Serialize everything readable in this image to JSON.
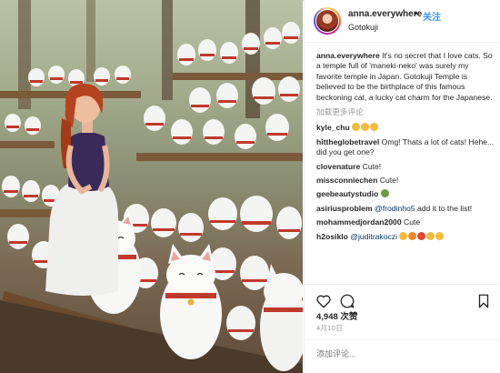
{
  "header": {
    "username": "anna.everywhere",
    "separator": "•",
    "follow_label": "关注",
    "location": "Gotokuji"
  },
  "caption": {
    "username": "anna.everywhere",
    "text": "It's no secret that I love cats. So a temple full of 'maneki-neko' was surely my favorite temple in Japan. Gotokuji Temple is believed to be the birthplace of this famous beckoning cat, a lucky cat charm for the Japanese."
  },
  "load_more": "加载更多评论",
  "comments": [
    {
      "username": "kyle_chu",
      "text": "",
      "emoji": [
        "#f6b93b",
        "#f6b93b",
        "#f6b93b"
      ]
    },
    {
      "username": "hittheglobetravel",
      "text": "Omg! Thats a lot of cats! Hehe... did you get one?",
      "emoji": []
    },
    {
      "username": "clovenature",
      "text": "Cute!",
      "emoji": []
    },
    {
      "username": "missconniechen",
      "text": "Cute!",
      "emoji": []
    },
    {
      "username": "geebeautystudio",
      "text": "",
      "emoji": [
        "#6a9a3a"
      ]
    },
    {
      "username": "asiriusproblem",
      "mention": "@frodinho5",
      "text": "add it to the list!",
      "emoji": []
    },
    {
      "username": "mohammedjordan2000",
      "text": "Cute",
      "emoji": []
    },
    {
      "username": "h2osiklo",
      "mention": "@juditrakoczi",
      "text": "",
      "emoji": [
        "#f6b93b",
        "#f08a24",
        "#e8452c",
        "#f6b93b",
        "#f6b93b"
      ]
    }
  ],
  "actions": {
    "heart_icon": "heart-icon",
    "comment_icon": "comment-icon",
    "bookmark_icon": "bookmark-icon"
  },
  "likes": "4,948 次赞",
  "date": "4月10日",
  "add_comment_placeholder": "添加评论...",
  "colors": {
    "link_blue": "#3897f0",
    "mention_blue": "#003569",
    "muted": "#999999",
    "border": "#efefef"
  }
}
